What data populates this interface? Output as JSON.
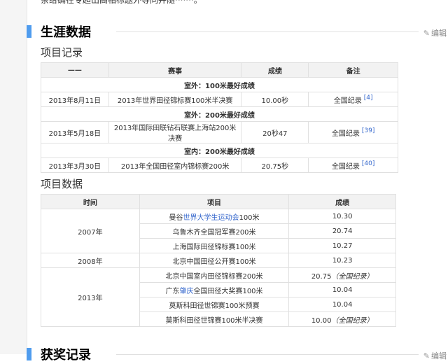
{
  "intro_tail": "亲给确在专超出高相标题外等同并随·······。",
  "section1": {
    "title": "生涯数据",
    "edit": "编辑"
  },
  "section2": {
    "title": "获奖记录",
    "edit": "编辑"
  },
  "records": {
    "title": "项目记录",
    "headers": [
      "——",
      "赛事",
      "成绩",
      "备注"
    ],
    "groups": [
      {
        "label": "室外：100米最好成绩",
        "row": {
          "date": "2013年8月11日",
          "event": "2013年世界田径锦标赛100米半决赛",
          "result": "10.00秒",
          "note": "全国纪录",
          "ref": "[4]"
        }
      },
      {
        "label": "室外：200米最好成绩",
        "row": {
          "date": "2013年5月18日",
          "event": "2013年国际田联钻石联赛上海站200米决赛",
          "result": "20秒47",
          "note": "全国纪录",
          "ref": "[39]"
        }
      },
      {
        "label": "室内：200米最好成绩",
        "row": {
          "date": "2013年3月30日",
          "event": "2013年全国田径室内锦标赛200米",
          "result": "20.75秒",
          "note": "全国纪录",
          "ref": "[40]"
        }
      }
    ]
  },
  "stats": {
    "title": "项目数据",
    "headers": [
      "时间",
      "项目",
      "成绩"
    ],
    "years": [
      "2007年",
      "2008年",
      "2013年"
    ],
    "rows": [
      {
        "pre": "曼谷",
        "link": "世界大学生运动会",
        "post": "100米",
        "result": "10.30",
        "note": ""
      },
      {
        "pre": "乌鲁木齐全国冠军赛200米",
        "link": "",
        "post": "",
        "result": "20.74",
        "note": ""
      },
      {
        "pre": "上海国际田径锦标赛100米",
        "link": "",
        "post": "",
        "result": "10.27",
        "note": ""
      },
      {
        "pre": "北京中国田径公开赛100米",
        "link": "",
        "post": "",
        "result": "10.23",
        "note": ""
      },
      {
        "pre": "北京中国室内田径锦标赛200米",
        "link": "",
        "post": "",
        "result": "20.75",
        "note": "（全国纪录）"
      },
      {
        "pre": "广东",
        "link": "肇庆",
        "post": "全国田径大奖赛100米",
        "result": "10.04",
        "note": ""
      },
      {
        "pre": "莫斯科田径世锦赛100米预赛",
        "link": "",
        "post": "",
        "result": "10.04",
        "note": ""
      },
      {
        "pre": "莫斯科田径世锦赛100米半决赛",
        "link": "",
        "post": "",
        "result": "10.00",
        "note": "（全国纪录）"
      }
    ]
  },
  "colors": {
    "accent": "#4f9cee",
    "link": "#3366cc",
    "header_bg": "#f2f2f2",
    "border": "#e0e0e0"
  },
  "icons": {
    "edit": "pencil-icon"
  }
}
